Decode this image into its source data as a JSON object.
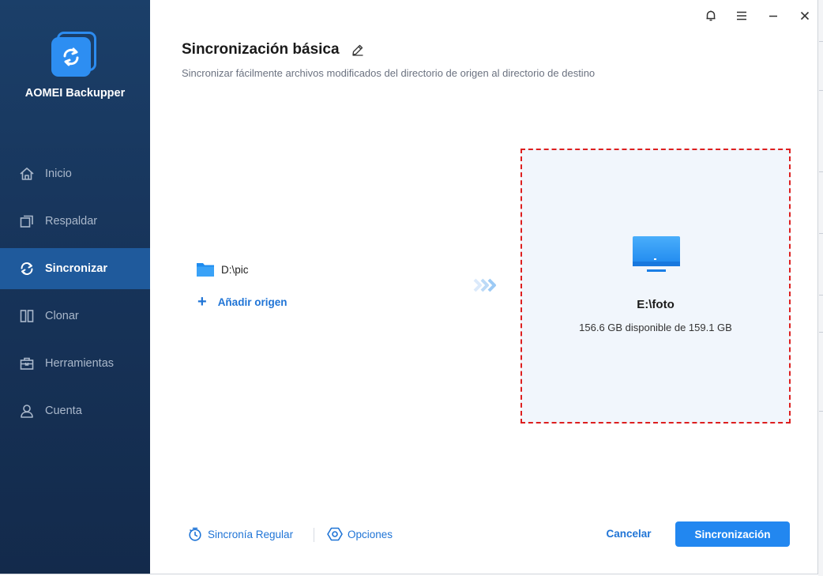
{
  "app": {
    "name": "AOMEI Backupper"
  },
  "sidebar": {
    "items": [
      {
        "label": "Inicio",
        "icon": "home-icon",
        "active": false
      },
      {
        "label": "Respaldar",
        "icon": "backup-icon",
        "active": false
      },
      {
        "label": "Sincronizar",
        "icon": "sync-icon",
        "active": true
      },
      {
        "label": "Clonar",
        "icon": "clone-icon",
        "active": false
      },
      {
        "label": "Herramientas",
        "icon": "toolbox-icon",
        "active": false
      },
      {
        "label": "Cuenta",
        "icon": "user-icon",
        "active": false
      }
    ]
  },
  "titlebar": {
    "icons": [
      "bell-icon",
      "menu-icon",
      "minimize-icon",
      "close-icon"
    ]
  },
  "header": {
    "title": "Sincronización básica",
    "subtitle": "Sincronizar fácilmente archivos modificados del directorio de origen al directorio de destino"
  },
  "source": {
    "path": "D:\\pic",
    "add_label": "Añadir origen"
  },
  "destination": {
    "path": "E:\\foto",
    "space": "156.6 GB disponible de 159.1 GB"
  },
  "footer": {
    "schedule_label": "Sincronía Regular",
    "options_label": "Opciones",
    "cancel_label": "Cancelar",
    "start_label": "Sincronización"
  },
  "colors": {
    "sidebar_bg": "#17345a",
    "active_item": "#1f5a9c",
    "accent": "#2287f0",
    "link": "#1f74d6",
    "dest_border": "#dd1f1f",
    "dest_bg": "#f1f6fc"
  }
}
